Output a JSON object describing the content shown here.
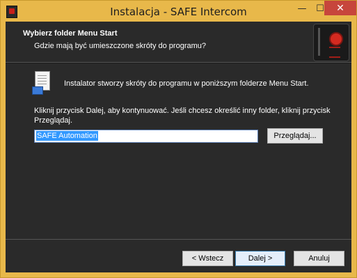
{
  "window": {
    "title": "Instalacja - SAFE Intercom",
    "minimize": "—",
    "maximize": "☐",
    "close": "✕"
  },
  "header": {
    "title": "Wybierz folder Menu Start",
    "subtitle": "Gdzie mają być umieszczone skróty do programu?"
  },
  "body": {
    "info": "Instalator stworzy skróty do programu w poniższym folderze Menu Start.",
    "instructions": "Kliknij przycisk Dalej, aby kontynuować. Jeśli chcesz określić inny folder, kliknij przycisk Przeglądaj.",
    "folder_value": "SAFE Automation",
    "browse_label": "Przeglądaj..."
  },
  "footer": {
    "back_label": "< Wstecz",
    "next_label": "Dalej >",
    "cancel_label": "Anuluj"
  }
}
